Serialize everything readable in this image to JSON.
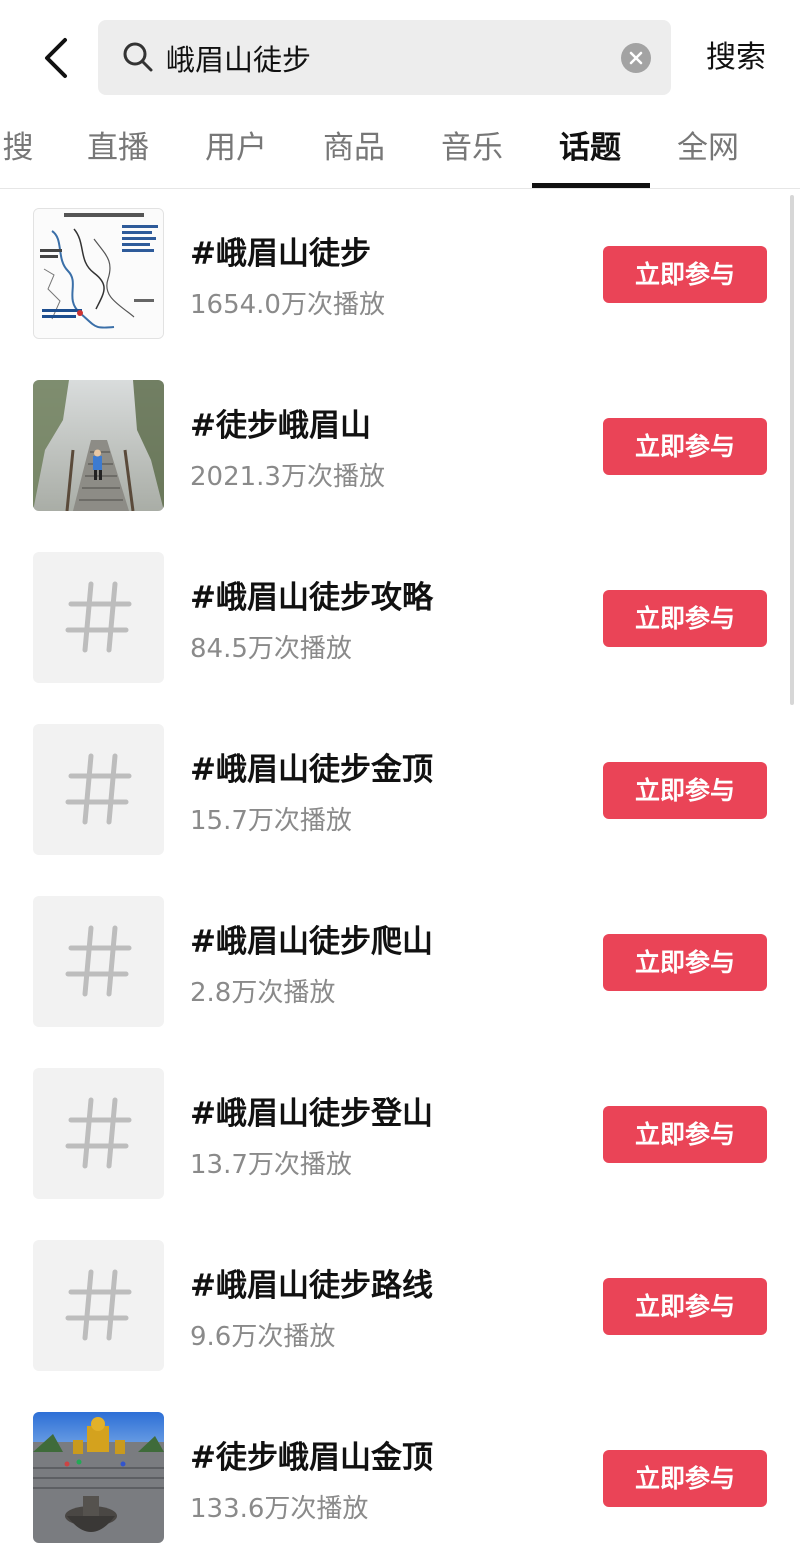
{
  "header": {
    "back_icon": "chevron-left-icon",
    "search": {
      "value": "峨眉山徒步",
      "search_icon": "search-icon",
      "clear_icon": "close-circle-icon"
    },
    "search_button_label": "搜索"
  },
  "tabs": [
    {
      "label": "搜",
      "active": false
    },
    {
      "label": "直播",
      "active": false
    },
    {
      "label": "用户",
      "active": false
    },
    {
      "label": "商品",
      "active": false
    },
    {
      "label": "音乐",
      "active": false
    },
    {
      "label": "话题",
      "active": true
    },
    {
      "label": "全网",
      "active": false
    }
  ],
  "topics": [
    {
      "title": "#峨眉山徒步",
      "plays": "1654.0万次播放",
      "thumb": "map",
      "button": "立即参与"
    },
    {
      "title": "#徒步峨眉山",
      "plays": "2021.3万次播放",
      "thumb": "photo-misty-stairs",
      "button": "立即参与"
    },
    {
      "title": "#峨眉山徒步攻略",
      "plays": "84.5万次播放",
      "thumb": "hash",
      "button": "立即参与"
    },
    {
      "title": "#峨眉山徒步金顶",
      "plays": "15.7万次播放",
      "thumb": "hash",
      "button": "立即参与"
    },
    {
      "title": "#峨眉山徒步爬山",
      "plays": "2.8万次播放",
      "thumb": "hash",
      "button": "立即参与"
    },
    {
      "title": "#峨眉山徒步登山",
      "plays": "13.7万次播放",
      "thumb": "hash",
      "button": "立即参与"
    },
    {
      "title": "#峨眉山徒步路线",
      "plays": "9.6万次播放",
      "thumb": "hash",
      "button": "立即参与"
    },
    {
      "title": "#徒步峨眉山金顶",
      "plays": "133.6万次播放",
      "thumb": "photo-golden-summit",
      "button": "立即参与"
    }
  ],
  "colors": {
    "accent": "#ea4457",
    "secondary_text": "#8a8a8a",
    "search_bg": "#ededed"
  }
}
